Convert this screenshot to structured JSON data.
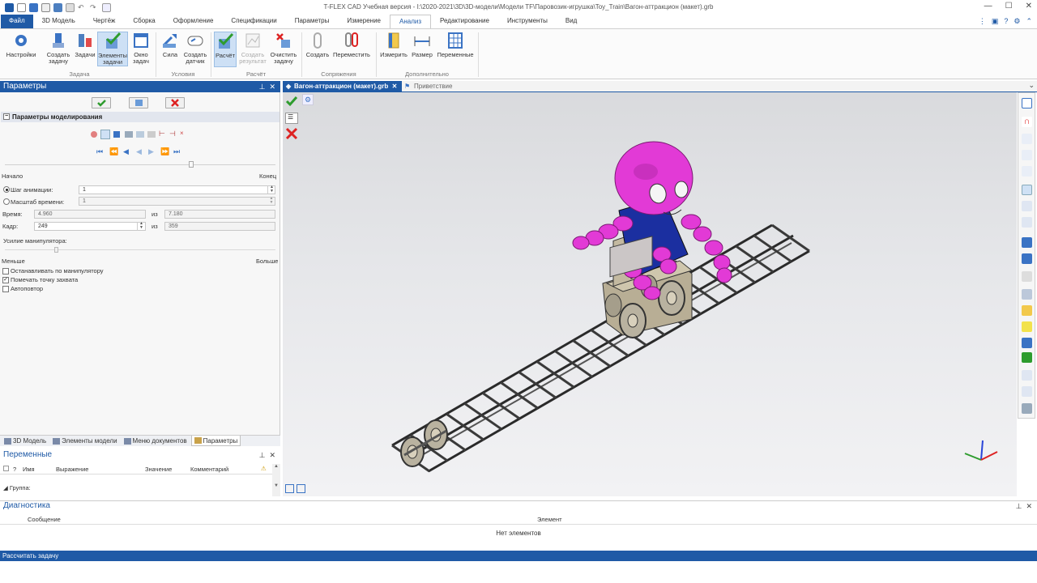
{
  "window": {
    "title": "T-FLEX CAD Учебная версия - I:\\2020-2021\\3D\\3D-модели\\Модели TF\\Паровозик-игрушка\\Toy_Train\\Вагон-аттракцион (макет).grb"
  },
  "menu": {
    "items": [
      "Файл",
      "3D Модель",
      "Чертёж",
      "Сборка",
      "Оформление",
      "Спецификации",
      "Параметры",
      "Измерение",
      "Анализ",
      "Редактирование",
      "Инструменты",
      "Вид"
    ],
    "active": "Анализ"
  },
  "ribbon": {
    "buttons": [
      {
        "label": "Настройки"
      },
      {
        "label": "Создать\nзадачу"
      },
      {
        "label": "Задачи"
      },
      {
        "label": "Элементы\nзадачи"
      },
      {
        "label": "Окно\nзадач"
      },
      {
        "label": "Сила"
      },
      {
        "label": "Создать\nдатчик"
      },
      {
        "label": "Расчёт"
      },
      {
        "label": "Создать\nрезультат"
      },
      {
        "label": "Очистить\nзадачу"
      },
      {
        "label": "Создать"
      },
      {
        "label": "Переместить"
      },
      {
        "label": "Измерить"
      },
      {
        "label": "Размер"
      },
      {
        "label": "Переменные"
      }
    ],
    "groups": [
      "Задача",
      "Условия",
      "Расчёт",
      "Сопряжения",
      "Дополнительно"
    ]
  },
  "params_panel": {
    "title": "Параметры",
    "section_title": "Параметры моделирования",
    "start_label": "Начало",
    "end_label": "Конец",
    "anim_step_label": "Шаг анимации:",
    "anim_step_value": "1",
    "time_scale_label": "Масштаб времени:",
    "time_scale_value": "1",
    "time_label": "Время:",
    "time_value": "4.960",
    "of_label": "из",
    "time_total": "7.180",
    "frame_label": "Кадр:",
    "frame_value": "249",
    "frame_total": "359",
    "force_label": "Усилие манипулятора:",
    "less_label": "Меньше",
    "more_label": "Больше",
    "checkboxes": [
      {
        "label": "Останавливать по манипулятору",
        "checked": false
      },
      {
        "label": "Помечать точку захвата",
        "checked": true
      },
      {
        "label": "Автоповтор",
        "checked": false
      }
    ],
    "animation_progress": 0.69
  },
  "bottom_tabs": [
    "3D Модель",
    "Элементы модели",
    "Меню документов",
    "Параметры"
  ],
  "bottom_tabs_active": "Параметры",
  "variables": {
    "title": "Переменные",
    "columns": [
      "?",
      "Имя",
      "Выражение",
      "Значение",
      "Комментарий"
    ],
    "group_label": "Группа:"
  },
  "doc_tabs": [
    "Вагон-аттракцион (макет).grb",
    "Приветствие"
  ],
  "diagnostics": {
    "title": "Диагностика",
    "columns": [
      "Сообщение",
      "Элемент"
    ],
    "empty_text": "Нет элементов"
  },
  "status": {
    "text": "Рассчитать задачу"
  },
  "colors": {
    "accent": "#1f5aa6",
    "figure": "#e23ad6",
    "frame": "#1b2fa0"
  }
}
